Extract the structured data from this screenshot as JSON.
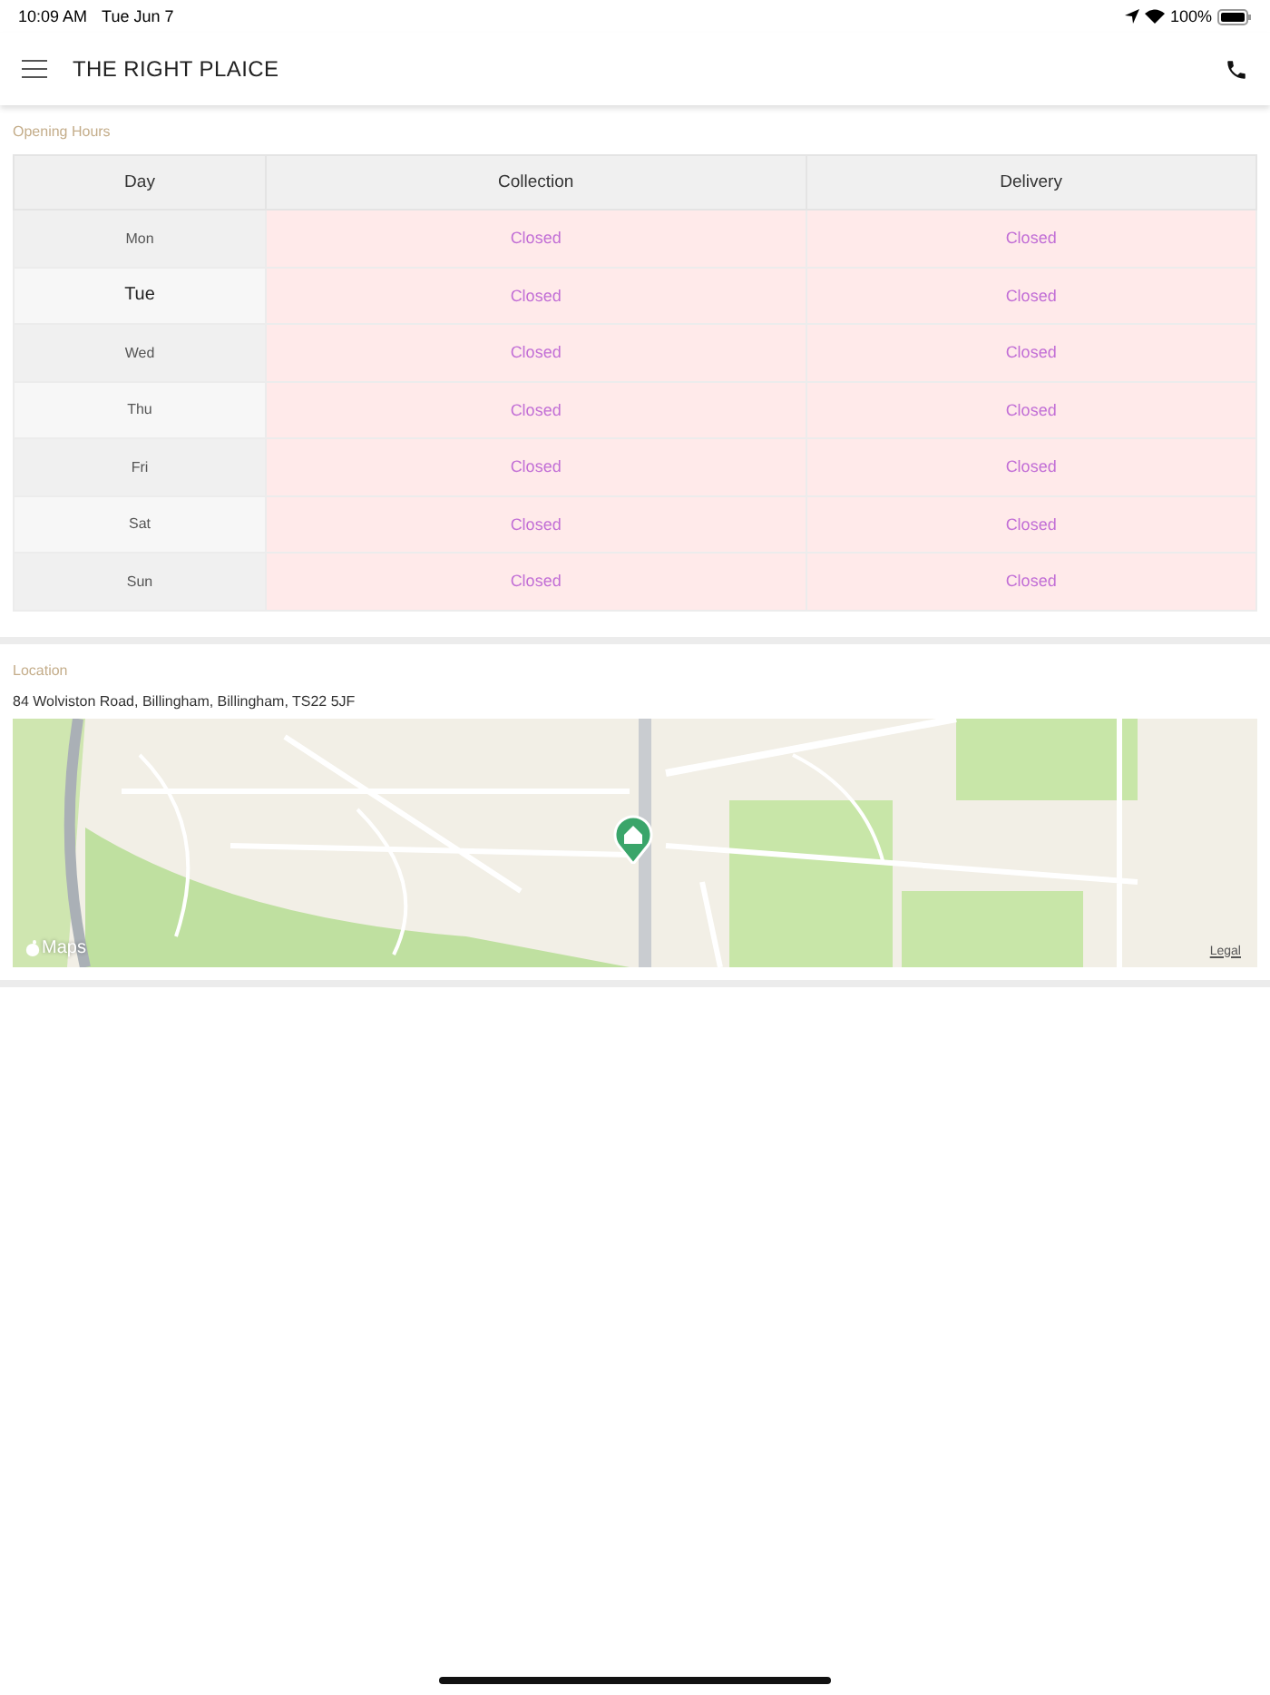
{
  "status_bar": {
    "time": "10:09 AM",
    "date": "Tue Jun 7",
    "battery": "100%"
  },
  "header": {
    "title": "THE RIGHT PLAICE"
  },
  "opening_hours": {
    "label": "Opening Hours",
    "columns": [
      "Day",
      "Collection",
      "Delivery"
    ],
    "rows": [
      {
        "day": "Mon",
        "collection": "Closed",
        "delivery": "Closed",
        "today": false
      },
      {
        "day": "Tue",
        "collection": "Closed",
        "delivery": "Closed",
        "today": true
      },
      {
        "day": "Wed",
        "collection": "Closed",
        "delivery": "Closed",
        "today": false
      },
      {
        "day": "Thu",
        "collection": "Closed",
        "delivery": "Closed",
        "today": false
      },
      {
        "day": "Fri",
        "collection": "Closed",
        "delivery": "Closed",
        "today": false
      },
      {
        "day": "Sat",
        "collection": "Closed",
        "delivery": "Closed",
        "today": false
      },
      {
        "day": "Sun",
        "collection": "Closed",
        "delivery": "Closed",
        "today": false
      }
    ]
  },
  "location": {
    "label": "Location",
    "address": "84 Wolviston Road, Billingham, Billingham, TS22 5JF",
    "map": {
      "kind": "picture",
      "logo": "Maps",
      "legal": "Legal"
    }
  }
}
